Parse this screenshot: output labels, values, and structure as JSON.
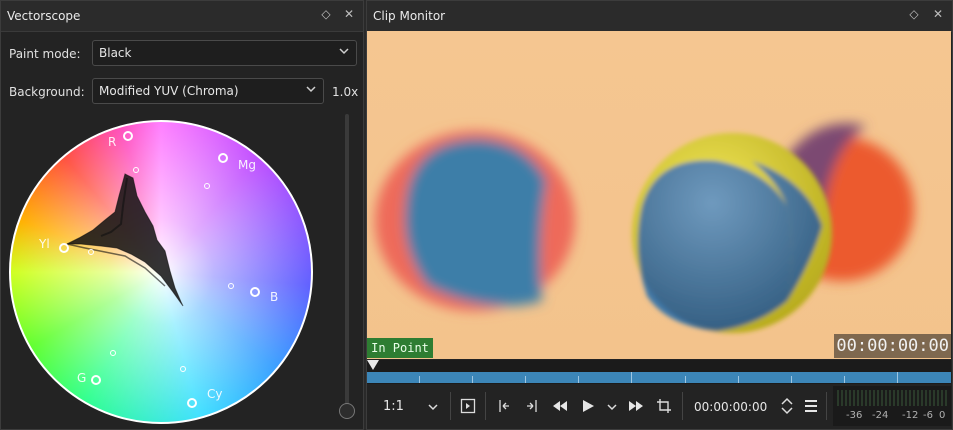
{
  "vectorscope": {
    "title": "Vectorscope",
    "paint_mode_label": "Paint mode:",
    "paint_mode_value": "Black",
    "background_label": "Background:",
    "background_value": "Modified YUV (Chroma)",
    "gain": "1.0x",
    "targets": {
      "r": "R",
      "mg": "Mg",
      "yl": "Yl",
      "b": "B",
      "g": "G",
      "cy": "Cy"
    },
    "gain_slider_level": 0
  },
  "clip_monitor": {
    "title": "Clip Monitor",
    "in_point": "In Point",
    "timecode_overlay": "00:00:00:00",
    "zoom": "1:1",
    "timecode": "00:00:00:00",
    "audio_scale": [
      "-36",
      "-24",
      "-12",
      "-6",
      "0"
    ]
  },
  "icons": {
    "float": "diamond-icon",
    "close": "close-icon"
  },
  "colors": {
    "panel_bg": "#232323",
    "in_point_green": "#2e7d32",
    "ruler_blue": "#3c86b8"
  }
}
